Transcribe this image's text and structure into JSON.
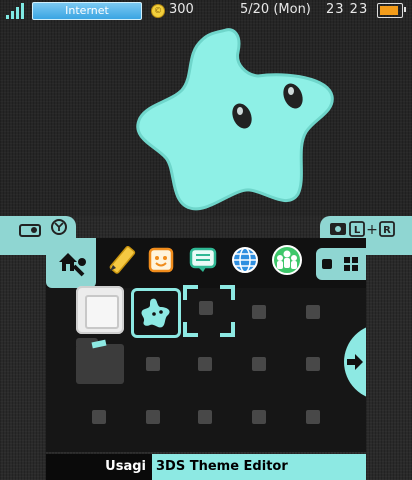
{
  "status_bar": {
    "connection_label": "Internet",
    "coin_count": "300",
    "date": "5/20 (Mon)",
    "time": "23 23",
    "battery_level": 0.9,
    "signal_bars": 4
  },
  "top_screen": {
    "wallpaper": "luma-star"
  },
  "camera_shortcuts": {
    "left_icon": "camera-y-icon",
    "right_icon": "camera-l-r-icon"
  },
  "toolbar": {
    "icons": [
      "home-settings-icon",
      "pencil-notes-icon",
      "friend-face-icon",
      "notifications-icon",
      "internet-globe-icon",
      "miiverse-icon"
    ],
    "view_toggle": [
      "single-view-icon",
      "grid-view-icon"
    ]
  },
  "footer": {
    "username": "Usagi",
    "title": "3DS Theme Editor"
  },
  "colors": {
    "accent": "#8de9e3",
    "wallpaper_dark": "#262626",
    "star": "#8ef0e6"
  }
}
